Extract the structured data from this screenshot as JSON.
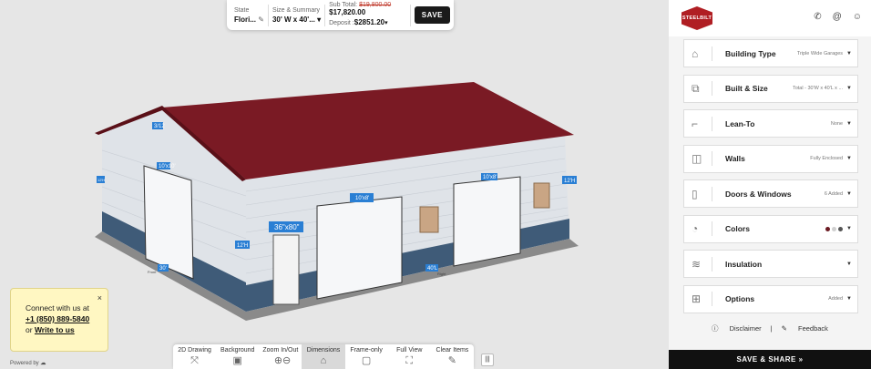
{
  "topbar": {
    "state_label": "State",
    "state_value": "Flori...",
    "size_label": "Size & Summary",
    "size_value": "30' W x 40'...",
    "subtotal_label": "Sub Total:",
    "subtotal_old": "$19,800.00",
    "subtotal_new": "$17,820.00",
    "deposit_label": "Deposit :",
    "deposit_value": "$2851.20",
    "save_label": "SAVE"
  },
  "building_labels": {
    "pitch": "3/12",
    "front_door_left": "10'x10'",
    "front_door_small": "36\"x80\"",
    "side_door_mid": "10'x8'",
    "side_door_right": "10'x8'",
    "height_front": "12'H",
    "height_right": "12'H",
    "height_left": "12'H",
    "width_front": "30'",
    "length_side": "40'L",
    "small_left": "12'H",
    "bottom_front": "Front",
    "bottom_side": "Right"
  },
  "tools": [
    {
      "label": "2D Drawing",
      "icon": "2d-drawing-icon",
      "glyph": "⤧"
    },
    {
      "label": "Background",
      "icon": "background-icon",
      "glyph": "▣"
    },
    {
      "label": "Zoom In/Out",
      "icon": "zoom-icon",
      "glyph": "⊕⊖"
    },
    {
      "label": "Dimensions",
      "icon": "dimensions-icon",
      "glyph": "⌂"
    },
    {
      "label": "Frame-only",
      "icon": "frame-icon",
      "glyph": "▢"
    },
    {
      "label": "Full View",
      "icon": "full-view-icon",
      "glyph": "⛶"
    },
    {
      "label": "Clear Items",
      "icon": "clear-icon",
      "glyph": "✎"
    }
  ],
  "connect": {
    "line1": "Connect with us at",
    "phone": "+1 (850) 889-5840",
    "or": "or",
    "write": "Write to us",
    "close": "×"
  },
  "powered": "Powered by",
  "sidebar": {
    "logo": "STEELBILT",
    "menu": [
      {
        "label": "Building Type",
        "value": "Triple Wide Garages",
        "icon": "building-icon",
        "glyph": "⌂"
      },
      {
        "label": "Built & Size",
        "value": "Total - 30'W x 40'L x ...",
        "icon": "size-icon",
        "glyph": "⧉"
      },
      {
        "label": "Lean-To",
        "value": "None",
        "icon": "lean-to-icon",
        "glyph": "⌐"
      },
      {
        "label": "Walls",
        "value": "Fully Enclosed",
        "icon": "walls-icon",
        "glyph": "◫"
      },
      {
        "label": "Doors & Windows",
        "value": "6 Added",
        "icon": "doors-icon",
        "glyph": "▯"
      },
      {
        "label": "Colors",
        "value": "",
        "icon": "palette-icon",
        "glyph": "◔"
      },
      {
        "label": "Insulation",
        "value": "",
        "icon": "insulation-icon",
        "glyph": "≋"
      },
      {
        "label": "Options",
        "value": "Added",
        "icon": "options-icon",
        "glyph": "⊞"
      }
    ],
    "disclaimer": "Disclaimer",
    "feedback": "Feedback",
    "save_share": "SAVE & SHARE »"
  },
  "colors": {
    "roof": "#7a1a24",
    "wainscot": "#3f5b78",
    "wall": "#dfe3e8",
    "swatch1": "#6b1a22",
    "swatch2": "#cfcfcf",
    "swatch3": "#555555"
  }
}
